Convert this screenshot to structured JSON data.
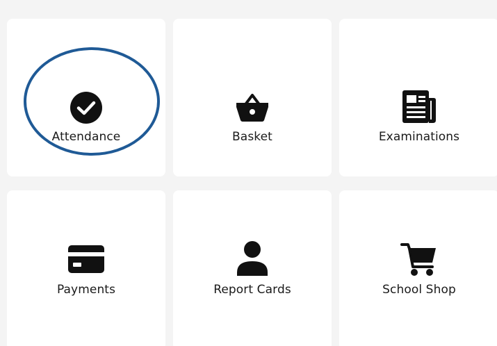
{
  "tiles": [
    {
      "label": "Attendance",
      "icon": "check-circle-icon"
    },
    {
      "label": "Basket",
      "icon": "basket-icon"
    },
    {
      "label": "Examinations",
      "icon": "newspaper-icon"
    },
    {
      "label": "Payments",
      "icon": "credit-card-icon"
    },
    {
      "label": "Report Cards",
      "icon": "person-icon"
    },
    {
      "label": "School Shop",
      "icon": "shopping-cart-icon"
    }
  ],
  "colors": {
    "background": "#f4f4f4",
    "tile": "#ffffff",
    "icon": "#111111",
    "highlight": "#1f5a96"
  }
}
